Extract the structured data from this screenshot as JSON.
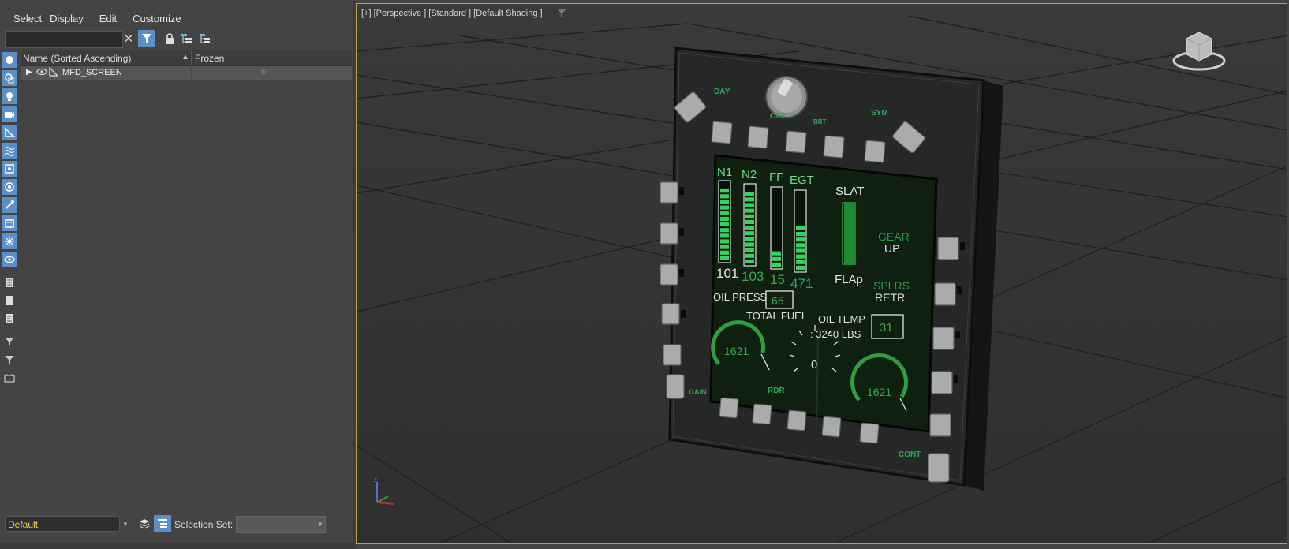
{
  "menu": [
    "Select",
    "Display",
    "Edit",
    "Customize"
  ],
  "explorer": {
    "search_placeholder": "",
    "col_name": "Name (Sorted Ascending)",
    "col_frozen": "Frozen",
    "rows": [
      {
        "name": "MFD_SCREEN"
      }
    ]
  },
  "bottom": {
    "layer": "Default",
    "selection_set_label": "Selection Set:",
    "selection_set_value": ""
  },
  "viewport": {
    "label": "[+] [Perspective ] [Standard ] [Default Shading ]"
  },
  "mfd": {
    "bezel_labels": {
      "day": "DAY",
      "off": "OFF",
      "brt": "BRT",
      "sym": "SYM",
      "gain": "GAIN",
      "rdr": "RDR",
      "cont": "CONT"
    },
    "gauges": [
      {
        "label": "N1",
        "value": "101",
        "level": 0.95
      },
      {
        "label": "N2",
        "value": "103",
        "level": 0.9
      },
      {
        "label": "FF",
        "value": "15",
        "level": 0.2
      },
      {
        "label": "EGT",
        "value": "471",
        "level": 0.55
      }
    ],
    "slat_label": "SLAT",
    "flap_label": "FLAp",
    "gear_label": "GEAR",
    "gear_state": "UP",
    "splrs_label": "SPLRS",
    "splrs_state": "RETR",
    "oil_press_label": "OIL PRESS",
    "oil_press_value": "65",
    "oil_temp_label": "OIL TEMP",
    "oil_temp_value": "31",
    "total_fuel_label": "TOTAL FUEL",
    "total_fuel_value": ": 3240 LBS",
    "left_dial": "1621",
    "right_dial": "1621",
    "center_dial": "0"
  },
  "colors": {
    "accent": "#5a8fc7",
    "viewport_border": "#c4a23a",
    "screen_green": "#35d45a",
    "screen_bg": "#0f1f10"
  }
}
